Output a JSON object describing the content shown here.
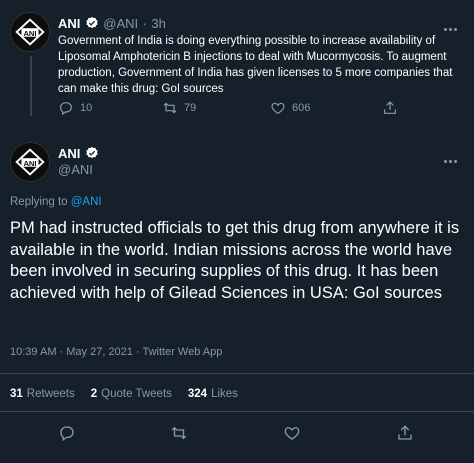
{
  "previous_tweet": {
    "name": "ANI",
    "handle": "@ANI",
    "time": "3h",
    "text": "Government of India is doing everything possible to increase availability of Liposomal Amphotericin B injections to deal with Mucormycosis. To augment production, Government of India has given licenses to 5 more companies that can make this drug: GoI sources",
    "reply_count": "10",
    "retweet_count": "79",
    "like_count": "606",
    "avatar_text": "ANI"
  },
  "tweet": {
    "name": "ANI",
    "handle": "@ANI",
    "avatar_text": "ANI",
    "replying_prefix": "Replying to",
    "replying_to": "@ANI",
    "text": "PM had instructed officials to get this drug from anywhere it is available in the world. Indian missions across the world have been involved in securing supplies of this drug. It has been achieved with help of Gilead Sciences in USA: GoI sources",
    "timestamp": "10:39 AM · May 27, 2021 · Twitter Web App",
    "retweets_count": "31",
    "retweets_label": "Retweets",
    "quote_count": "2",
    "quote_label": "Quote Tweets",
    "likes_count": "324",
    "likes_label": "Likes"
  },
  "colors": {
    "background": "#15202b",
    "secondary_text": "#8899a6",
    "link": "#1da1f2",
    "divider": "#38444d"
  },
  "icons": [
    "verified-icon",
    "reply-icon",
    "retweet-icon",
    "like-icon",
    "share-icon",
    "more-icon"
  ]
}
